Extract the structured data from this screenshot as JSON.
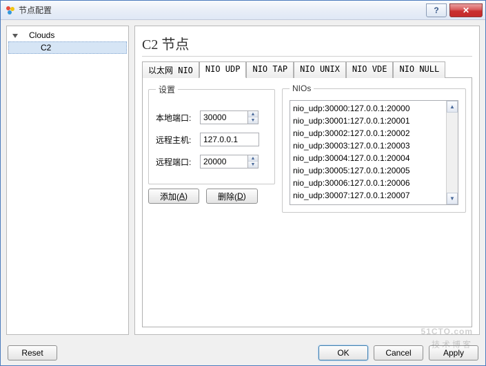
{
  "window": {
    "title": "节点配置"
  },
  "tree": {
    "root": "Clouds",
    "child": "C2"
  },
  "heading": "C2 节点",
  "tabs": [
    "以太网 NIO",
    "NIO UDP",
    "NIO TAP",
    "NIO UNIX",
    "NIO VDE",
    "NIO NULL"
  ],
  "settings": {
    "legend": "设置",
    "local_port_label": "本地端口:",
    "local_port": "30000",
    "remote_host_label": "远程主机:",
    "remote_host": "127.0.0.1",
    "remote_port_label": "远程端口:",
    "remote_port": "20000",
    "add_label": "添加(",
    "add_key": "A",
    "add_label_end": ")",
    "delete_label": "删除(",
    "delete_key": "D",
    "delete_label_end": ")"
  },
  "nios": {
    "legend": "NIOs",
    "items": [
      "nio_udp:30000:127.0.0.1:20000",
      "nio_udp:30001:127.0.0.1:20001",
      "nio_udp:30002:127.0.0.1:20002",
      "nio_udp:30003:127.0.0.1:20003",
      "nio_udp:30004:127.0.0.1:20004",
      "nio_udp:30005:127.0.0.1:20005",
      "nio_udp:30006:127.0.0.1:20006",
      "nio_udp:30007:127.0.0.1:20007"
    ]
  },
  "buttons": {
    "reset": "Reset",
    "ok": "OK",
    "cancel": "Cancel",
    "apply": "Apply"
  },
  "watermark": {
    "main": "51CTO.com",
    "sub": "技术博客"
  }
}
